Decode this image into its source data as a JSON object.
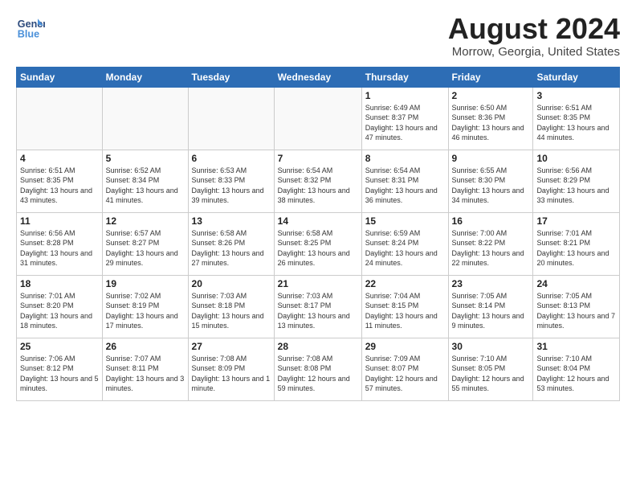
{
  "header": {
    "logo_line1": "General",
    "logo_line2": "Blue",
    "main_title": "August 2024",
    "subtitle": "Morrow, Georgia, United States"
  },
  "weekdays": [
    "Sunday",
    "Monday",
    "Tuesday",
    "Wednesday",
    "Thursday",
    "Friday",
    "Saturday"
  ],
  "weeks": [
    [
      {
        "day": "",
        "info": ""
      },
      {
        "day": "",
        "info": ""
      },
      {
        "day": "",
        "info": ""
      },
      {
        "day": "",
        "info": ""
      },
      {
        "day": "1",
        "info": "Sunrise: 6:49 AM\nSunset: 8:37 PM\nDaylight: 13 hours\nand 47 minutes."
      },
      {
        "day": "2",
        "info": "Sunrise: 6:50 AM\nSunset: 8:36 PM\nDaylight: 13 hours\nand 46 minutes."
      },
      {
        "day": "3",
        "info": "Sunrise: 6:51 AM\nSunset: 8:35 PM\nDaylight: 13 hours\nand 44 minutes."
      }
    ],
    [
      {
        "day": "4",
        "info": "Sunrise: 6:51 AM\nSunset: 8:35 PM\nDaylight: 13 hours\nand 43 minutes."
      },
      {
        "day": "5",
        "info": "Sunrise: 6:52 AM\nSunset: 8:34 PM\nDaylight: 13 hours\nand 41 minutes."
      },
      {
        "day": "6",
        "info": "Sunrise: 6:53 AM\nSunset: 8:33 PM\nDaylight: 13 hours\nand 39 minutes."
      },
      {
        "day": "7",
        "info": "Sunrise: 6:54 AM\nSunset: 8:32 PM\nDaylight: 13 hours\nand 38 minutes."
      },
      {
        "day": "8",
        "info": "Sunrise: 6:54 AM\nSunset: 8:31 PM\nDaylight: 13 hours\nand 36 minutes."
      },
      {
        "day": "9",
        "info": "Sunrise: 6:55 AM\nSunset: 8:30 PM\nDaylight: 13 hours\nand 34 minutes."
      },
      {
        "day": "10",
        "info": "Sunrise: 6:56 AM\nSunset: 8:29 PM\nDaylight: 13 hours\nand 33 minutes."
      }
    ],
    [
      {
        "day": "11",
        "info": "Sunrise: 6:56 AM\nSunset: 8:28 PM\nDaylight: 13 hours\nand 31 minutes."
      },
      {
        "day": "12",
        "info": "Sunrise: 6:57 AM\nSunset: 8:27 PM\nDaylight: 13 hours\nand 29 minutes."
      },
      {
        "day": "13",
        "info": "Sunrise: 6:58 AM\nSunset: 8:26 PM\nDaylight: 13 hours\nand 27 minutes."
      },
      {
        "day": "14",
        "info": "Sunrise: 6:58 AM\nSunset: 8:25 PM\nDaylight: 13 hours\nand 26 minutes."
      },
      {
        "day": "15",
        "info": "Sunrise: 6:59 AM\nSunset: 8:24 PM\nDaylight: 13 hours\nand 24 minutes."
      },
      {
        "day": "16",
        "info": "Sunrise: 7:00 AM\nSunset: 8:22 PM\nDaylight: 13 hours\nand 22 minutes."
      },
      {
        "day": "17",
        "info": "Sunrise: 7:01 AM\nSunset: 8:21 PM\nDaylight: 13 hours\nand 20 minutes."
      }
    ],
    [
      {
        "day": "18",
        "info": "Sunrise: 7:01 AM\nSunset: 8:20 PM\nDaylight: 13 hours\nand 18 minutes."
      },
      {
        "day": "19",
        "info": "Sunrise: 7:02 AM\nSunset: 8:19 PM\nDaylight: 13 hours\nand 17 minutes."
      },
      {
        "day": "20",
        "info": "Sunrise: 7:03 AM\nSunset: 8:18 PM\nDaylight: 13 hours\nand 15 minutes."
      },
      {
        "day": "21",
        "info": "Sunrise: 7:03 AM\nSunset: 8:17 PM\nDaylight: 13 hours\nand 13 minutes."
      },
      {
        "day": "22",
        "info": "Sunrise: 7:04 AM\nSunset: 8:15 PM\nDaylight: 13 hours\nand 11 minutes."
      },
      {
        "day": "23",
        "info": "Sunrise: 7:05 AM\nSunset: 8:14 PM\nDaylight: 13 hours\nand 9 minutes."
      },
      {
        "day": "24",
        "info": "Sunrise: 7:05 AM\nSunset: 8:13 PM\nDaylight: 13 hours\nand 7 minutes."
      }
    ],
    [
      {
        "day": "25",
        "info": "Sunrise: 7:06 AM\nSunset: 8:12 PM\nDaylight: 13 hours\nand 5 minutes."
      },
      {
        "day": "26",
        "info": "Sunrise: 7:07 AM\nSunset: 8:11 PM\nDaylight: 13 hours\nand 3 minutes."
      },
      {
        "day": "27",
        "info": "Sunrise: 7:08 AM\nSunset: 8:09 PM\nDaylight: 13 hours\nand 1 minute."
      },
      {
        "day": "28",
        "info": "Sunrise: 7:08 AM\nSunset: 8:08 PM\nDaylight: 12 hours\nand 59 minutes."
      },
      {
        "day": "29",
        "info": "Sunrise: 7:09 AM\nSunset: 8:07 PM\nDaylight: 12 hours\nand 57 minutes."
      },
      {
        "day": "30",
        "info": "Sunrise: 7:10 AM\nSunset: 8:05 PM\nDaylight: 12 hours\nand 55 minutes."
      },
      {
        "day": "31",
        "info": "Sunrise: 7:10 AM\nSunset: 8:04 PM\nDaylight: 12 hours\nand 53 minutes."
      }
    ]
  ]
}
